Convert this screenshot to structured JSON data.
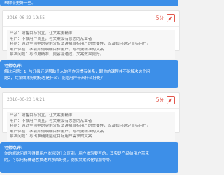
{
  "top_bubble": {
    "text": "帮你会更好一些。"
  },
  "submission1": {
    "time": "2016-06-22 19:55",
    "score_value": "5",
    "score_unit": "分",
    "lines": [
      "产品：销售目标设立，让文案更精准",
      "用户：不做用户调查，写文案没有意思的从业者",
      "特别：通过生活中的实例分析法讲解目标用户的重要性，以及如何确定目标用户。",
      "用户体验：学会如何明确目标用户，写出更精准的文案",
      "解决问题：写作更精准，更容易通过，文案效果更好。"
    ]
  },
  "comment1": {
    "title": "老师点评:",
    "lines": [
      "解决问题：1. 与升级还是帮助个人的写作习惯有关系，跟你的课程并不能解决这个问",
      "题2，文案效果好的标志是什么？能给用户带来什么好处？"
    ]
  },
  "submission2": {
    "time": "2016-06-23 14:21",
    "score_value": "5",
    "score_unit": "分",
    "lines": [
      "产品：销售目标设立，让文案更精准",
      "用户：不做用户调查，写文案没有思想的从业者",
      "特别：通过生活中的实例分析法讲解目标用户的重要性，以及如何确定目标用户。",
      "用户体验：学会如何明确目标用户，写出更精准的文案",
      "解决问题：写出准确更贴近目标用户需求的文案"
    ]
  },
  "comment2": {
    "title": "老师点评:",
    "lines": [
      "你的解决问题写得跟用户体验没什么区别。用户体验要写的，其实是产品给用户带来",
      "的，可以用标体语言描述的东西好处，例如文案转化增加等等。"
    ]
  }
}
